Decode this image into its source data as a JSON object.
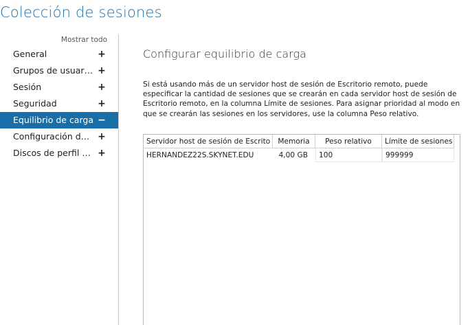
{
  "window": {
    "title": "Colección de sesiones"
  },
  "sidebar": {
    "show_all": "Mostrar todo",
    "items": [
      {
        "label": "General",
        "icon": "+"
      },
      {
        "label": "Grupos de usuarios",
        "icon": "+"
      },
      {
        "label": "Sesión",
        "icon": "+"
      },
      {
        "label": "Seguridad",
        "icon": "+"
      },
      {
        "label": "Equilibrio de carga",
        "icon": "−",
        "active": true
      },
      {
        "label": "Configuración de...",
        "icon": "+"
      },
      {
        "label": "Discos de perfil de...",
        "icon": "+"
      }
    ]
  },
  "main": {
    "section_title": "Configurar equilibrio de carga",
    "description": "Si está usando más de un servidor host de sesión de Escritorio remoto, puede especificar la cantidad de sesiones que se crearán en cada servidor host de sesión de Escritorio remoto, en la columna Límite de sesiones. Para asignar prioridad al modo en que se crearán las sesiones en los servidores, use la columna Peso relativo.",
    "table": {
      "columns": [
        "Servidor host de sesión de Escrito",
        "Memoria",
        "Peso relativo",
        "Límite de sesiones"
      ],
      "rows": [
        {
          "server": "HERNANDEZ22S.SKYNET.EDU",
          "memory": "4,00 GB",
          "weight": "100",
          "limit": "999999"
        }
      ]
    }
  },
  "colors": {
    "accent": "#1a6ea8"
  }
}
